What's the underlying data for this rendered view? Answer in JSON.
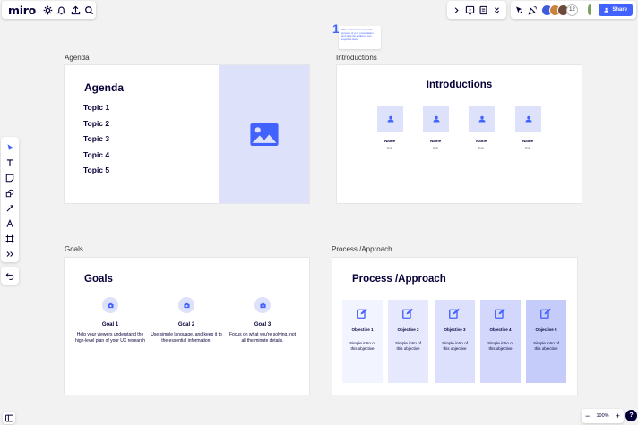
{
  "app": {
    "logo": "miro"
  },
  "top_right": {
    "collaborator_count": "12",
    "share_label": "Share"
  },
  "sticky": {
    "number": "1",
    "text": "Write a brief summary of the purpose of your presentation and what the audience can expect to learn."
  },
  "frames": {
    "agenda": {
      "label": "Agenda",
      "title": "Agenda",
      "topics": [
        "Topic 1",
        "Topic 2",
        "Topic 3",
        "Topic 4",
        "Topic 5"
      ]
    },
    "introductions": {
      "label": "Introductions",
      "title": "Introductions",
      "people": [
        {
          "name": "Name",
          "role": "Role"
        },
        {
          "name": "Name",
          "role": "Role"
        },
        {
          "name": "Name",
          "role": "Role"
        },
        {
          "name": "Name",
          "role": "Role"
        }
      ]
    },
    "goals": {
      "label": "Goals",
      "title": "Goals",
      "goals": [
        {
          "title": "Goal 1",
          "desc": "Help your viewers understand the high-level plan of your UX research"
        },
        {
          "title": "Goal 2",
          "desc": "Use simple language, and keep it to the essential information."
        },
        {
          "title": "Goal 3",
          "desc": "Focus on what you're solving, not all the minute details."
        }
      ]
    },
    "process": {
      "label": "Process /Approach",
      "title": "Process /Approach",
      "objectives": [
        {
          "title": "Objective 1",
          "desc": "Simple intro of this objective",
          "bg": "#f2f4ff"
        },
        {
          "title": "Objective 2",
          "desc": "Simple intro of this objective",
          "bg": "#e6e9fd"
        },
        {
          "title": "Objective 3",
          "desc": "Simple intro of this objective",
          "bg": "#dce0fc"
        },
        {
          "title": "Objective 4",
          "desc": "Simple intro of this objective",
          "bg": "#d2d7fb"
        },
        {
          "title": "Objective 5",
          "desc": "Simple intro of this objective",
          "bg": "#c5ccfa"
        }
      ]
    }
  },
  "zoom": {
    "level": "100%",
    "minus": "−",
    "plus": "+",
    "help": "?"
  },
  "colors": {
    "accent": "#4262ff",
    "placeholder": "#dde1fa",
    "icon": "#4262ff"
  }
}
